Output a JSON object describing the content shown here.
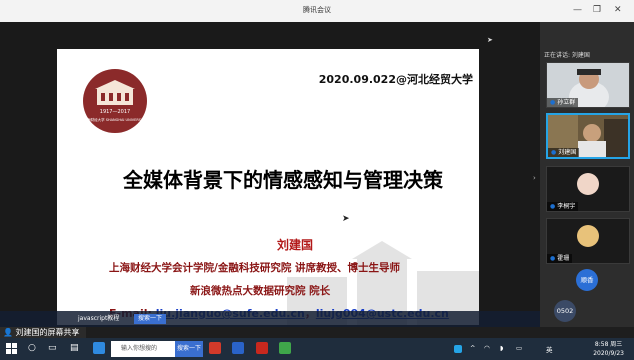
{
  "window": {
    "title": "腾讯会议",
    "minimize_glyph": "—",
    "restore_glyph": "❐",
    "close_glyph": "✕"
  },
  "slide": {
    "date": "2020.09.022@河北经贸大学",
    "logo_years": "1917—2017",
    "logo_text": "上海财经大学 SHANGHAI UNIVERSITY",
    "title": "全媒体背景下的情感感知与管理决策",
    "author": "刘建国",
    "affiliation_1": "上海财经大学会计学院/金融科技研究院 讲席教授、博士生导师",
    "affiliation_2": "新浪微热点大数据研究院 院长",
    "email_label": "E-mail: ",
    "email_1": "liu.jianguo@sufe.edu.cn",
    "email_sep": "，",
    "email_2": "liujg004@ustc.edu.cn"
  },
  "inner_taskbar": {
    "app_label": "javascript教程",
    "search_label": "搜索一下"
  },
  "sharing_bar": {
    "text": "刘建国的屏幕共享"
  },
  "sidebar": {
    "speaking": "正在讲话: 刘建国",
    "participants": [
      {
        "name": "孙立群"
      },
      {
        "name": "刘建国"
      },
      {
        "name": "李桐宇"
      },
      {
        "name": "霍珊"
      }
    ],
    "button_1": "顺香",
    "button_2": "0502"
  },
  "taskbar": {
    "search_placeholder": "输入你想搜的",
    "search_button": "搜索一下",
    "lang": "英",
    "time": "8:58 周三",
    "date": "2020/9/23"
  },
  "colors": {
    "accent": "#25a4e6",
    "slide_red": "#8a1515",
    "link_blue": "#1a3fc7"
  }
}
